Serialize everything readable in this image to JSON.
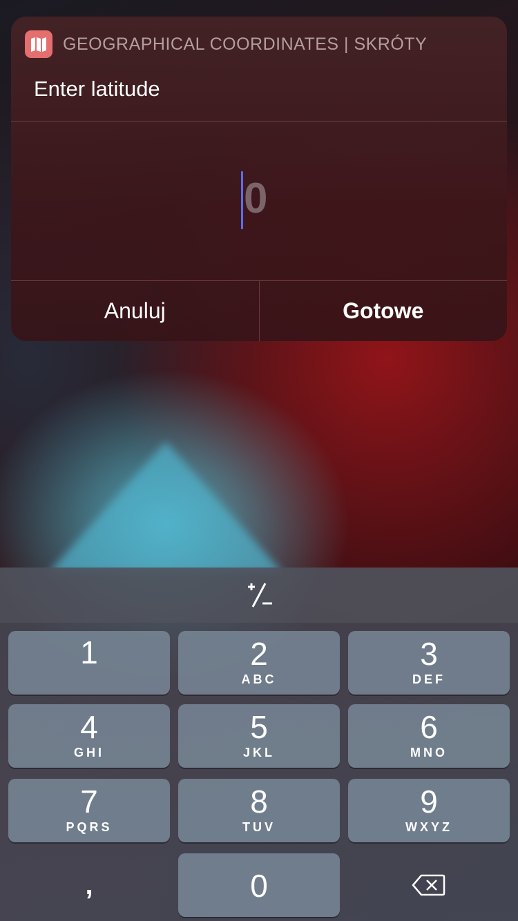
{
  "dialog": {
    "app_icon": "maps-icon",
    "app_name": "GEOGRAPHICAL COORDINATES | SKRÓTY",
    "prompt": "Enter latitude",
    "input_value": "0",
    "cancel_label": "Anuluj",
    "done_label": "Gotowe",
    "accent_color": "#5a6df0"
  },
  "keyboard": {
    "plus_minus_label": "⁺∕₋",
    "keys": [
      {
        "num": "1",
        "letters": ""
      },
      {
        "num": "2",
        "letters": "ABC"
      },
      {
        "num": "3",
        "letters": "DEF"
      },
      {
        "num": "4",
        "letters": "GHI"
      },
      {
        "num": "5",
        "letters": "JKL"
      },
      {
        "num": "6",
        "letters": "MNO"
      },
      {
        "num": "7",
        "letters": "PQRS"
      },
      {
        "num": "8",
        "letters": "TUV"
      },
      {
        "num": "9",
        "letters": "WXYZ"
      },
      {
        "num": "0",
        "letters": ""
      }
    ],
    "comma_label": ",",
    "delete_icon": "backspace-icon"
  }
}
